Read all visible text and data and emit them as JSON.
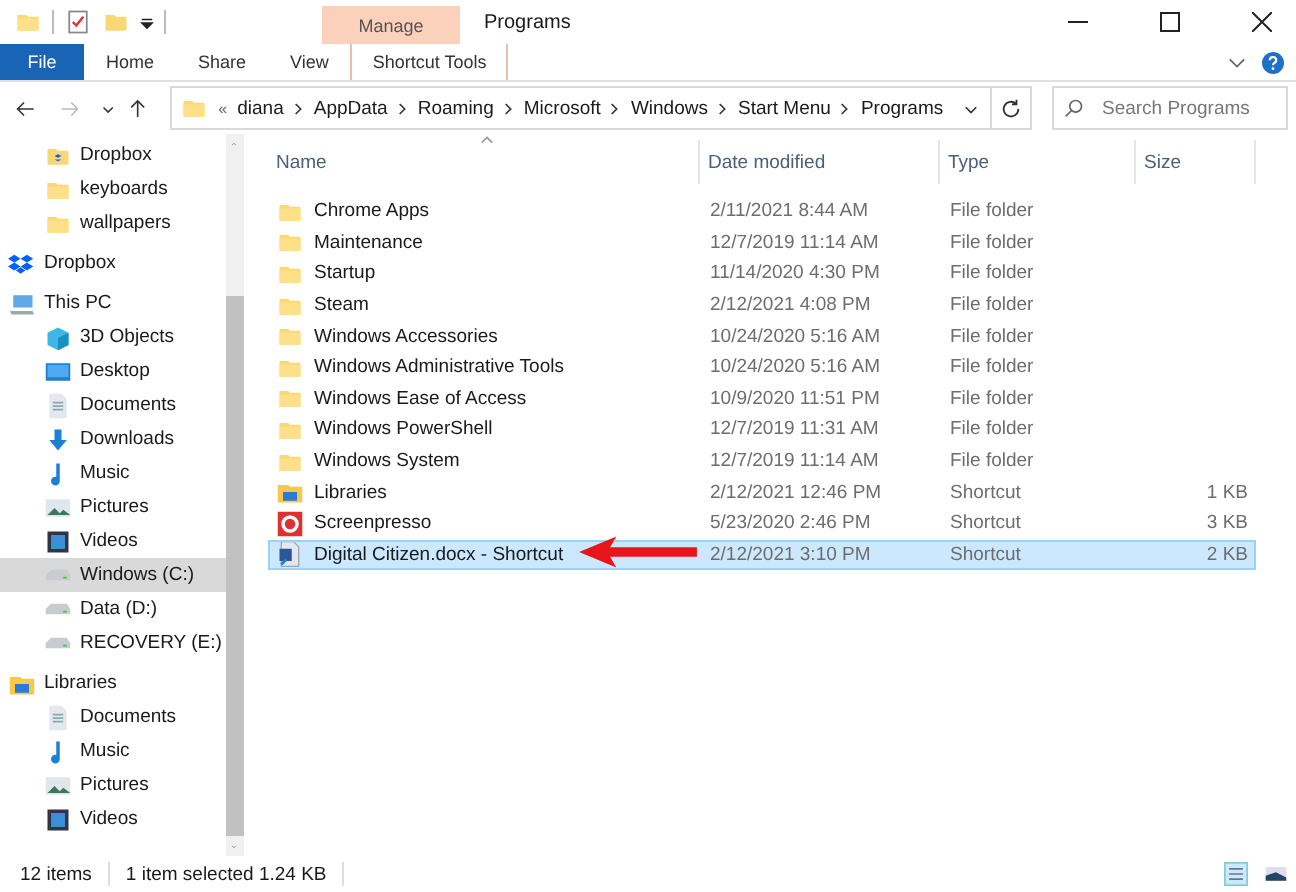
{
  "window": {
    "title": "Programs",
    "context_tab": "Manage"
  },
  "ribbon_tabs": [
    {
      "label": "File",
      "kind": "file",
      "selected": false
    },
    {
      "label": "Home",
      "kind": "tab",
      "selected": false
    },
    {
      "label": "Share",
      "kind": "tab",
      "selected": false
    },
    {
      "label": "View",
      "kind": "tab",
      "selected": false
    },
    {
      "label": "Shortcut Tools",
      "kind": "tab",
      "selected": false
    }
  ],
  "address": {
    "path": [
      "diana",
      "AppData",
      "Roaming",
      "Microsoft",
      "Windows",
      "Start Menu",
      "Programs"
    ],
    "overflow": "«"
  },
  "search": {
    "placeholder": "Search Programs"
  },
  "sidebar": {
    "items": [
      {
        "children": [
          {
            "label": "Dropbox",
            "kind": "dropbox-folder",
            "selected": false
          },
          {
            "label": "keyboards",
            "kind": "folder",
            "selected": false
          },
          {
            "label": "wallpapers",
            "kind": "folder",
            "selected": false
          }
        ]
      },
      {
        "label": "Dropbox",
        "kind": "dropbox",
        "selected": false
      },
      {
        "label": "This PC",
        "kind": "pc",
        "selected": false,
        "children": [
          {
            "label": "3D Objects",
            "kind": "cube",
            "selected": false
          },
          {
            "label": "Desktop",
            "kind": "desktop",
            "selected": false
          },
          {
            "label": "Documents",
            "kind": "document",
            "selected": false
          },
          {
            "label": "Downloads",
            "kind": "download",
            "selected": false
          },
          {
            "label": "Music",
            "kind": "music",
            "selected": false
          },
          {
            "label": "Pictures",
            "kind": "pictures",
            "selected": false
          },
          {
            "label": "Videos",
            "kind": "videos",
            "selected": false
          },
          {
            "label": "Windows (C:)",
            "kind": "drive",
            "selected": true
          },
          {
            "label": "Data (D:)",
            "kind": "drive",
            "selected": false
          },
          {
            "label": "RECOVERY (E:)",
            "kind": "drive",
            "selected": false
          }
        ]
      },
      {
        "label": "Libraries",
        "kind": "library",
        "selected": false,
        "children": [
          {
            "label": "Documents",
            "kind": "document",
            "selected": false
          },
          {
            "label": "Music",
            "kind": "music",
            "selected": false
          },
          {
            "label": "Pictures",
            "kind": "pictures",
            "selected": false
          },
          {
            "label": "Videos",
            "kind": "videos",
            "selected": false
          }
        ]
      }
    ]
  },
  "table": {
    "columns": [
      "Name",
      "Date modified",
      "Type",
      "Size"
    ],
    "rows": [
      {
        "kind": "folder",
        "name": "Chrome Apps",
        "date": "2/11/2021 8:44 AM",
        "type": "File folder",
        "selected": false
      },
      {
        "kind": "folder",
        "name": "Maintenance",
        "date": "12/7/2019 11:14 AM",
        "type": "File folder",
        "selected": false
      },
      {
        "kind": "folder",
        "name": "Startup",
        "date": "11/14/2020 4:30 PM",
        "type": "File folder",
        "selected": false
      },
      {
        "kind": "folder",
        "name": "Steam",
        "date": "2/12/2021 4:08 PM",
        "type": "File folder",
        "selected": false
      },
      {
        "kind": "folder",
        "name": "Windows Accessories",
        "date": "10/24/2020 5:16 AM",
        "type": "File folder",
        "selected": false
      },
      {
        "kind": "folder",
        "name": "Windows Administrative Tools",
        "date": "10/24/2020 5:16 AM",
        "type": "File folder",
        "selected": false
      },
      {
        "kind": "folder",
        "name": "Windows Ease of Access",
        "date": "10/9/2020 11:51 PM",
        "type": "File folder",
        "selected": false
      },
      {
        "kind": "folder",
        "name": "Windows PowerShell",
        "date": "12/7/2019 11:31 AM",
        "type": "File folder",
        "selected": false
      },
      {
        "kind": "folder",
        "name": "Windows System",
        "date": "12/7/2019 11:14 AM",
        "type": "File folder",
        "selected": false
      },
      {
        "kind": "library",
        "name": "Libraries",
        "date": "2/12/2021 12:46 PM",
        "type": "Shortcut",
        "size": "1 KB",
        "selected": false
      },
      {
        "kind": "screenpresso",
        "name": "Screenpresso",
        "date": "5/23/2020 2:46 PM",
        "type": "Shortcut",
        "size": "3 KB",
        "selected": false
      },
      {
        "kind": "shortcut-doc",
        "name": "Digital Citizen.docx - Shortcut",
        "date": "2/12/2021 3:10 PM",
        "type": "Shortcut",
        "size": "2 KB",
        "selected": true
      }
    ]
  },
  "status_bar": {
    "count": "12 items",
    "selection": "1 item selected  1.24 KB"
  }
}
